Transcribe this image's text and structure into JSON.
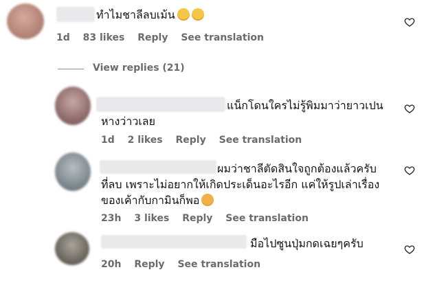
{
  "comments": [
    {
      "text": "ทำไมชาลีลบเม้น",
      "emoji": "sad-face-emoji",
      "age": "1d",
      "likes": "83 likes",
      "reply": "Reply",
      "translate": "See translation"
    },
    {
      "text_line1": "แน็กโดนใครไม่รู้พิมมาว่ายาวเปน",
      "text_line2": "หางว่าวเลย",
      "age": "1d",
      "likes": "2 likes",
      "reply": "Reply",
      "translate": "See translation"
    },
    {
      "text_line1": "ผมว่าชาลีตัดสินใจถูกต้องแล้วครับ",
      "text_line2": "ที่ลบ เพราะไม่อยากให้เกิดประเด็นอะไรอีก แค่ให้รูปเล่าเรื่อง",
      "text_line3": "ของเค้ากับกามินก็พอ",
      "emoji": "smiling-face-with-hearts-emoji",
      "age": "23h",
      "likes": "3 likes",
      "reply": "Reply",
      "translate": "See translation"
    },
    {
      "text": "มือไปซูนปุ่มกดเฉยๆครับ",
      "age": "20h",
      "reply": "Reply",
      "translate": "See translation"
    }
  ],
  "view_replies": "View replies (21)",
  "colors": {
    "meta": "#6b6b6b",
    "username_blur": "#e9e9ec"
  },
  "icons": {
    "like": "heart-outline-icon"
  }
}
